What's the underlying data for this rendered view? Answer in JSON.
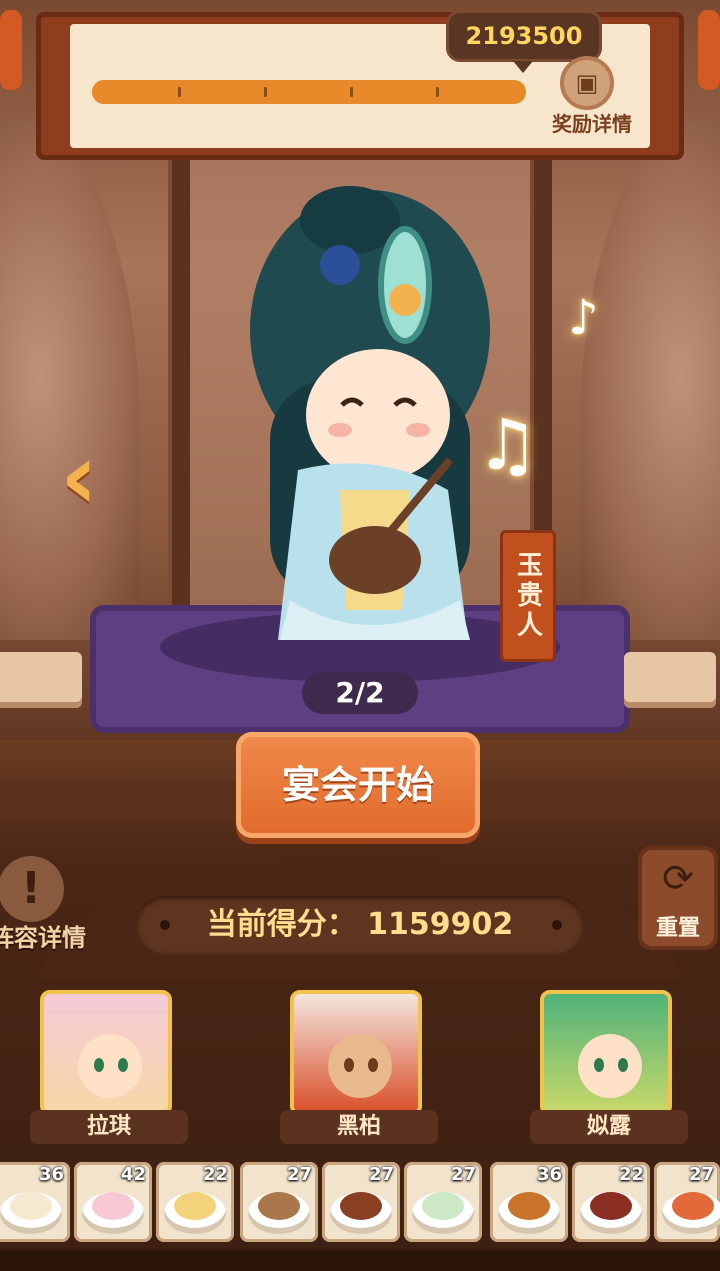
{
  "header": {
    "score": "2193500",
    "progress_fraction": 0.99,
    "reward_label": "奖励详情",
    "reward_icon": "treasure-chest-icon"
  },
  "stage": {
    "character_name": "玉贵人",
    "page_indicator": "2/2",
    "prev_arrow_icon": "chevron-left-icon"
  },
  "actions": {
    "start_label": "宴会开始",
    "current_score": "当前得分：   1159902",
    "lineup_label": "阵容详情",
    "reset_label": "重置"
  },
  "chefs": [
    {
      "name": "拉琪"
    },
    {
      "name": "黑柏"
    },
    {
      "name": "姒露"
    }
  ],
  "dishes": [
    {
      "count": "36"
    },
    {
      "count": "42"
    },
    {
      "count": "22"
    },
    {
      "count": "27"
    },
    {
      "count": "27"
    },
    {
      "count": "27"
    },
    {
      "count": "36"
    },
    {
      "count": "22"
    },
    {
      "count": "27"
    }
  ],
  "colors": {
    "accent": "#e06a2c",
    "gold": "#f2c34a",
    "banner": "#8e3e1f"
  }
}
